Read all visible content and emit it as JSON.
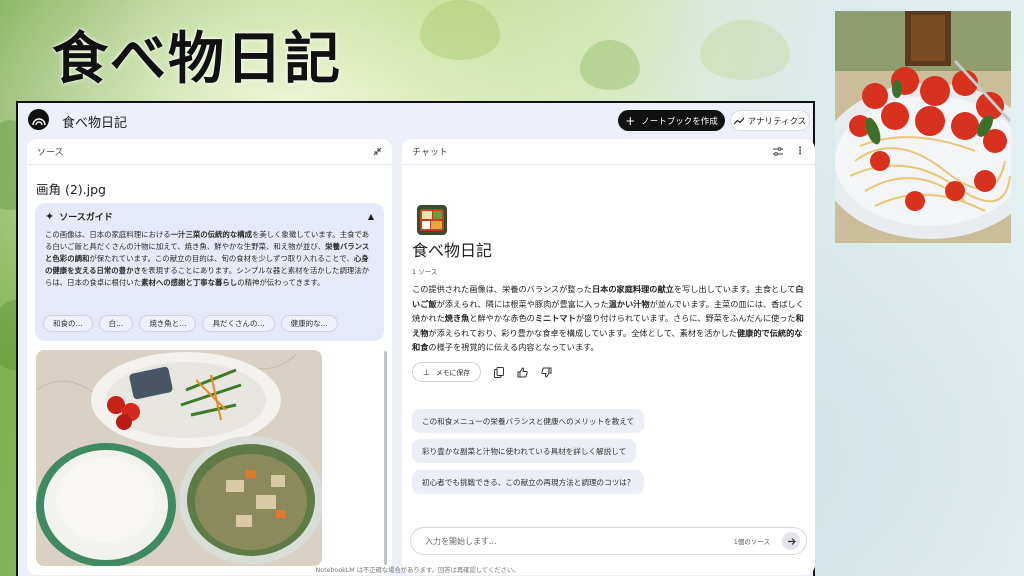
{
  "slide": {
    "title": "食べ物日記"
  },
  "app": {
    "name": "食べ物日記",
    "create_notebook": "ノートブックを作成",
    "analytics": "アナリティクス"
  },
  "sources": {
    "header": "ソース",
    "file_title": "画角 (2).jpg",
    "guide_title": "ソースガイド",
    "guide_text_parts": [
      {
        "t": "この画像は、日本の家庭料理における",
        "b": false
      },
      {
        "t": "一汁三菜の伝統的な構成",
        "b": true
      },
      {
        "t": "を美しく象徴しています。主食である白いご飯と具だくさんの汁物に加えて、焼き魚、鮮やかな生野菜、和え物が並び、",
        "b": false
      },
      {
        "t": "栄養バランスと色彩の調和",
        "b": true
      },
      {
        "t": "が保たれています。この献立の目的は、旬の食材を少しずつ取り入れることで、",
        "b": false
      },
      {
        "t": "心身の健康を支える日常の豊かさ",
        "b": true
      },
      {
        "t": "を表現することにあります。シンプルな器と素材を活かした調理法からは、日本の食卓に根付いた",
        "b": false
      },
      {
        "t": "素材への感謝と丁寧な暮らし",
        "b": true
      },
      {
        "t": "の精神が伝わってきます。",
        "b": false
      }
    ],
    "chips": [
      "和食の...",
      "白...",
      "焼き魚と...",
      "具だくさんの...",
      "健康的な..."
    ]
  },
  "chat": {
    "header": "チャット",
    "notebook_title": "食べ物日記",
    "source_count": "1 ソース",
    "summary_parts": [
      {
        "t": "この提供された画像は、栄養のバランスが整った",
        "b": false
      },
      {
        "t": "日本の家庭料理の献立",
        "b": true
      },
      {
        "t": "を写し出しています。主食として",
        "b": false
      },
      {
        "t": "白いご飯",
        "b": true
      },
      {
        "t": "が添えられ、隣には根菜や豚肉が豊富に入った",
        "b": false
      },
      {
        "t": "温かい汁物",
        "b": true
      },
      {
        "t": "が並んでいます。主菜の皿には、香ばしく焼かれた",
        "b": false
      },
      {
        "t": "焼き魚",
        "b": true
      },
      {
        "t": "と鮮やかな赤色の",
        "b": false
      },
      {
        "t": "ミニトマト",
        "b": true
      },
      {
        "t": "が盛り付けられています。さらに、野菜をふんだんに使った",
        "b": false
      },
      {
        "t": "和え物",
        "b": true
      },
      {
        "t": "が添えられており、彩り豊かな食卓を構成しています。全体として、素材を活かした",
        "b": false
      },
      {
        "t": "健康的で伝統的な和食",
        "b": true
      },
      {
        "t": "の様子を視覚的に伝える内容となっています。",
        "b": false
      }
    ],
    "save_note": "メモに保存",
    "suggestions": [
      "この和食メニューの栄養バランスと健康へのメリットを教えて",
      "彩り豊かな副菜と汁物に使われている具材を詳しく解説して",
      "初心者でも挑戦できる、この献立の再現方法と調理のコツは？"
    ],
    "input_placeholder": "入力を開始します...",
    "input_source_count": "1個のソース",
    "footer": "NotebookLM は不正確な場合があります。回答は再確認してください。"
  },
  "colors": {
    "accent_dark": "#111111",
    "panel_bg": "#eef0f9",
    "guide_bg": "#e6e9f8"
  },
  "icons": [
    "notebook-logo-icon",
    "plus-icon",
    "analytics-icon",
    "collapse-panel-icon",
    "sparkle-icon",
    "chevron-up-icon",
    "tune-icon",
    "more-vert-icon",
    "pin-icon",
    "copy-icon",
    "thumb-up-icon",
    "thumb-down-icon",
    "send-arrow-icon"
  ]
}
